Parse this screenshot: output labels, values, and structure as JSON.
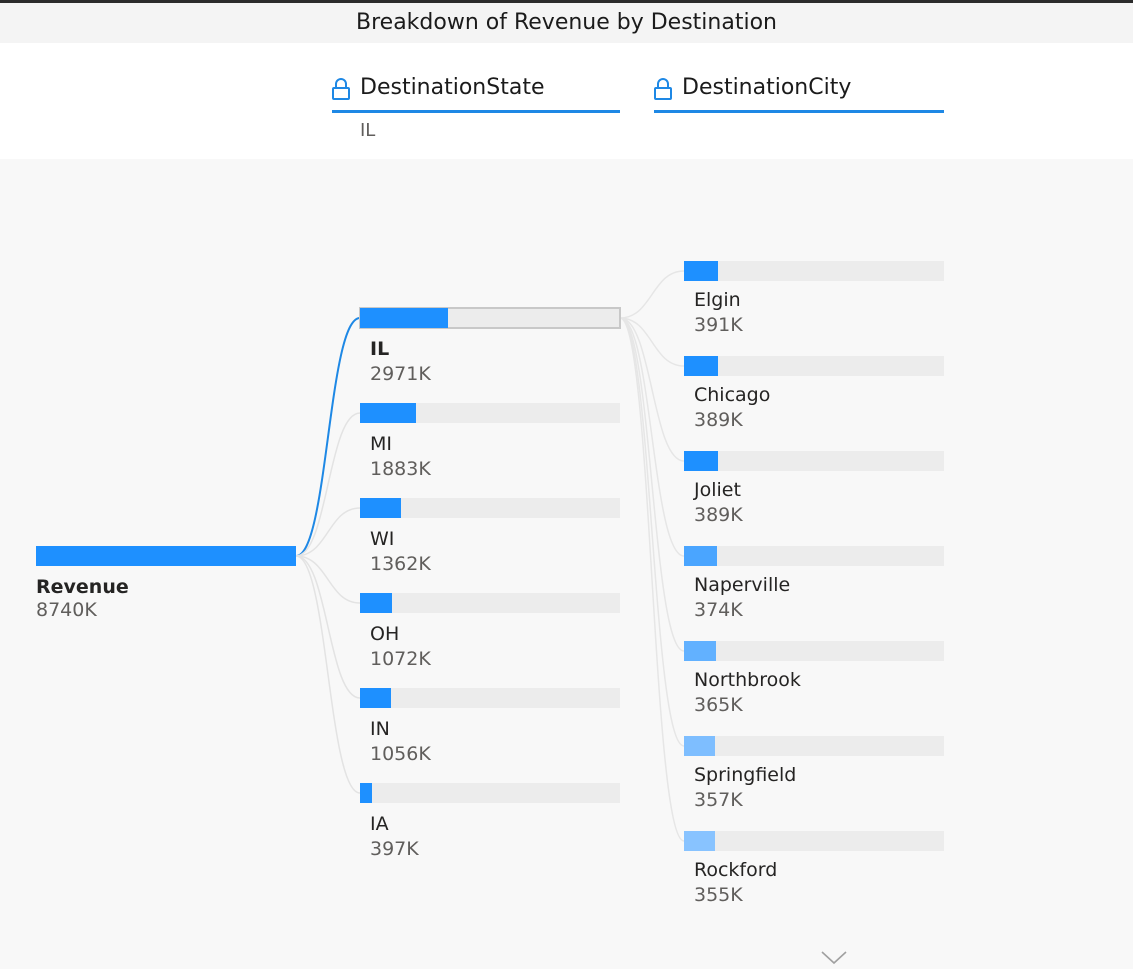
{
  "title": "Breakdown of Revenue by Destination",
  "levels": [
    {
      "label": "DestinationState",
      "icon": "lock-icon"
    },
    {
      "label": "DestinationCity",
      "icon": "lock-icon"
    }
  ],
  "filter_value": "IL",
  "accent": "#1e90ff",
  "chart_data": {
    "type": "decomposition-tree",
    "root": {
      "label": "Revenue",
      "value": "8740K",
      "amount": 8740
    },
    "states": [
      {
        "label": "IL",
        "value": "2971K",
        "amount": 2971,
        "selected": true
      },
      {
        "label": "MI",
        "value": "1883K",
        "amount": 1883
      },
      {
        "label": "WI",
        "value": "1362K",
        "amount": 1362
      },
      {
        "label": "OH",
        "value": "1072K",
        "amount": 1072
      },
      {
        "label": "IN",
        "value": "1056K",
        "amount": 1056
      },
      {
        "label": "IA",
        "value": "397K",
        "amount": 397
      }
    ],
    "cities": [
      {
        "label": "Elgin",
        "value": "391K",
        "amount": 391
      },
      {
        "label": "Chicago",
        "value": "389K",
        "amount": 389
      },
      {
        "label": "Joliet",
        "value": "389K",
        "amount": 389
      },
      {
        "label": "Naperville",
        "value": "374K",
        "amount": 374
      },
      {
        "label": "Northbrook",
        "value": "365K",
        "amount": 365
      },
      {
        "label": "Springfield",
        "value": "357K",
        "amount": 357
      },
      {
        "label": "Rockford",
        "value": "355K",
        "amount": 355
      }
    ]
  }
}
